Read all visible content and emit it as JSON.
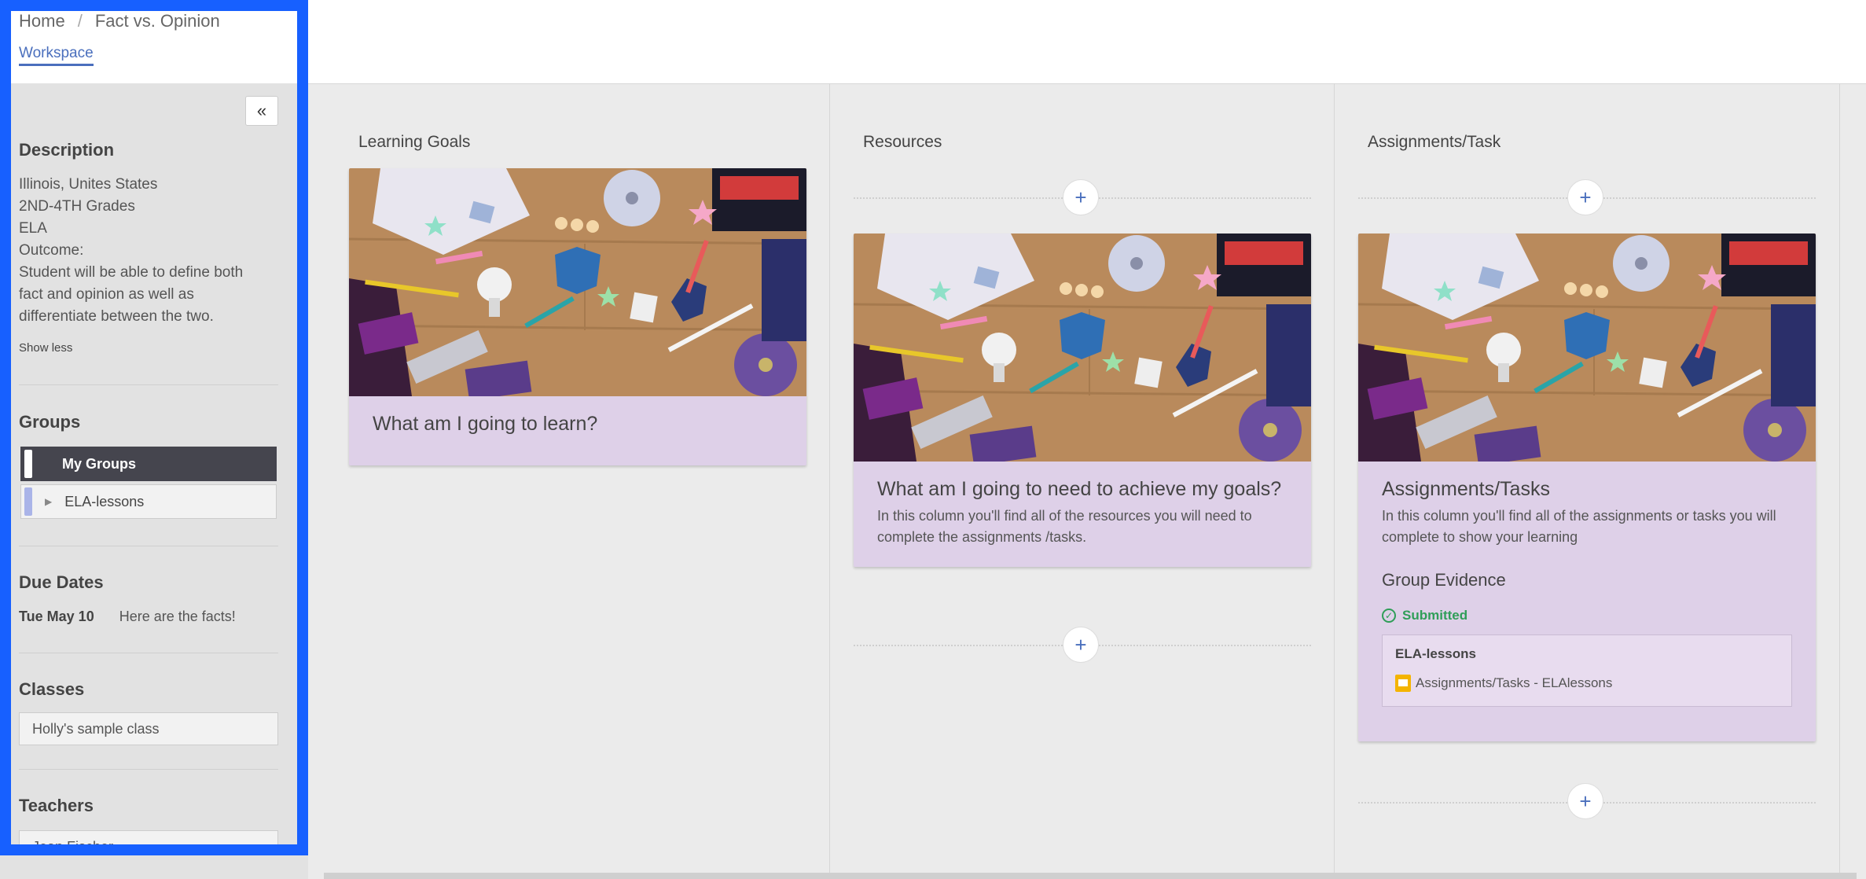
{
  "breadcrumb": {
    "home": "Home",
    "separator": "/",
    "current": "Fact vs. Opinion"
  },
  "workspace_link": "Workspace",
  "sidebar": {
    "collapse_icon": "«",
    "description_title": "Description",
    "description_lines": [
      "Illinois, Unites States",
      "2ND-4TH Grades",
      "ELA",
      "Outcome:",
      "Student will be able to define both fact and opinion as well as differentiate between the two."
    ],
    "show_less": "Show less",
    "groups_title": "Groups",
    "groups": [
      {
        "label": "My Groups",
        "bar_color": "#ffffff"
      },
      {
        "label": "ELA-lessons",
        "bar_color": "#aab4e8"
      }
    ],
    "due_title": "Due Dates",
    "due": {
      "date": "Tue May 10",
      "title": "Here are the facts!"
    },
    "classes_title": "Classes",
    "class_name": "Holly's sample class",
    "teachers_title": "Teachers",
    "teacher_name": "Jean Fischer"
  },
  "columns": {
    "learning": {
      "title": "Learning Goals",
      "card_title": "What am I going to learn?"
    },
    "resources": {
      "title": "Resources",
      "card_title": "What am I going to need to achieve my goals?",
      "card_desc": "In this column you'll find all of the resources you will need to complete the assignments /tasks."
    },
    "assignments": {
      "title": "Assignments/Task",
      "card_title": "Assignments/Tasks",
      "card_desc": "In this column you'll find all of the assignments or tasks you will complete to show your learning",
      "evidence_title": "Group Evidence",
      "status": "Submitted",
      "evidence_group": "ELA-lessons",
      "evidence_item": "Assignments/Tasks - ELAlessons"
    }
  },
  "add_icon": "+",
  "colors": {
    "accent": "#4a6fbd",
    "card_bg": "#ded0e8",
    "highlight": "#1760ff",
    "submitted": "#2f9e58"
  }
}
